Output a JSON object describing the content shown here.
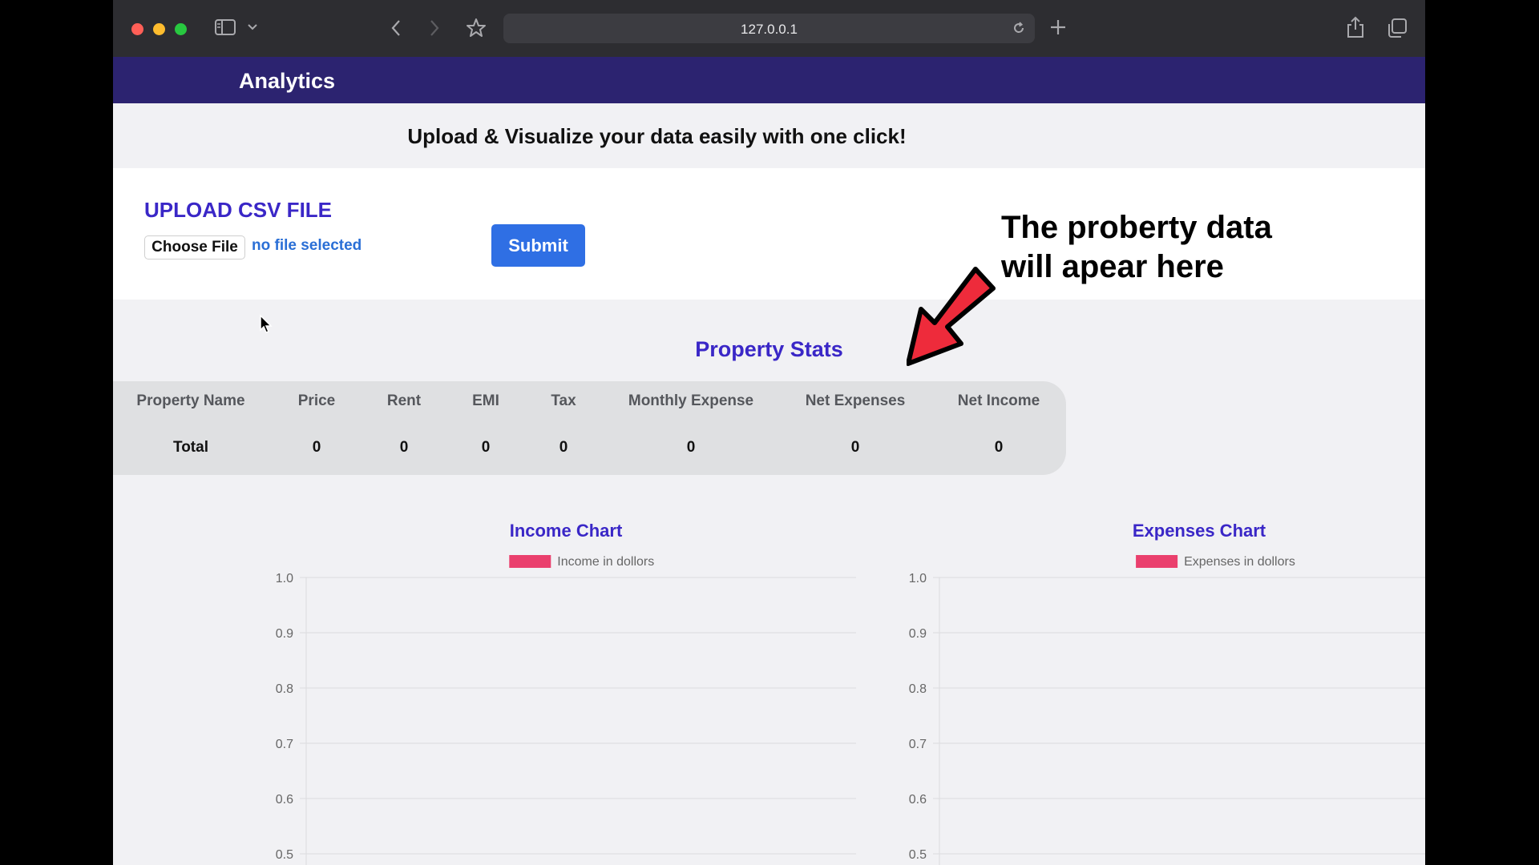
{
  "browser": {
    "address": "127.0.0.1",
    "colors": {
      "close": "#ff5f57",
      "minimize": "#febc2e",
      "zoom": "#28c840"
    },
    "icons": [
      "sidebar-icon",
      "chevron-down-icon",
      "back-icon",
      "forward-icon",
      "bookmark-star-icon",
      "reload-icon",
      "new-tab-icon",
      "share-icon",
      "tabs-overview-icon"
    ]
  },
  "navbar": {
    "brand": "Analytics",
    "color": "#2c2370"
  },
  "hero": {
    "tagline": "Upload & Visualize your data easily with one click!"
  },
  "upload": {
    "title": "UPLOAD CSV FILE",
    "choose_label": "Choose File",
    "file_status": "no file selected",
    "submit_label": "Submit"
  },
  "annotation": {
    "line1": "The proberty data",
    "line2": "will apear here",
    "arrow_color": "#ee2b3b"
  },
  "stats": {
    "title": "Property Stats",
    "headers": [
      "Property Name",
      "Price",
      "Rent",
      "EMI",
      "Tax",
      "Monthly Expense",
      "Net Expenses",
      "Net Income"
    ],
    "rows": [
      [
        "Total",
        "0",
        "0",
        "0",
        "0",
        "0",
        "0",
        "0"
      ]
    ]
  },
  "chart_data": [
    {
      "type": "bar",
      "title": "Income Chart",
      "series": [
        {
          "name": "Income in dollors",
          "color": "#ea3f6d",
          "values": []
        }
      ],
      "categories": [],
      "ylim": [
        0.5,
        1.0
      ],
      "yticks": [
        "1.0",
        "0.9",
        "0.8",
        "0.7",
        "0.6",
        "0.5"
      ],
      "grid": true,
      "legend": "top"
    },
    {
      "type": "bar",
      "title": "Expenses Chart",
      "series": [
        {
          "name": "Expenses in dollors",
          "color": "#ea3f6d",
          "values": []
        }
      ],
      "categories": [],
      "ylim": [
        0.5,
        1.0
      ],
      "yticks": [
        "1.0",
        "0.9",
        "0.8",
        "0.7",
        "0.6",
        "0.5"
      ],
      "grid": true,
      "legend": "top"
    }
  ]
}
